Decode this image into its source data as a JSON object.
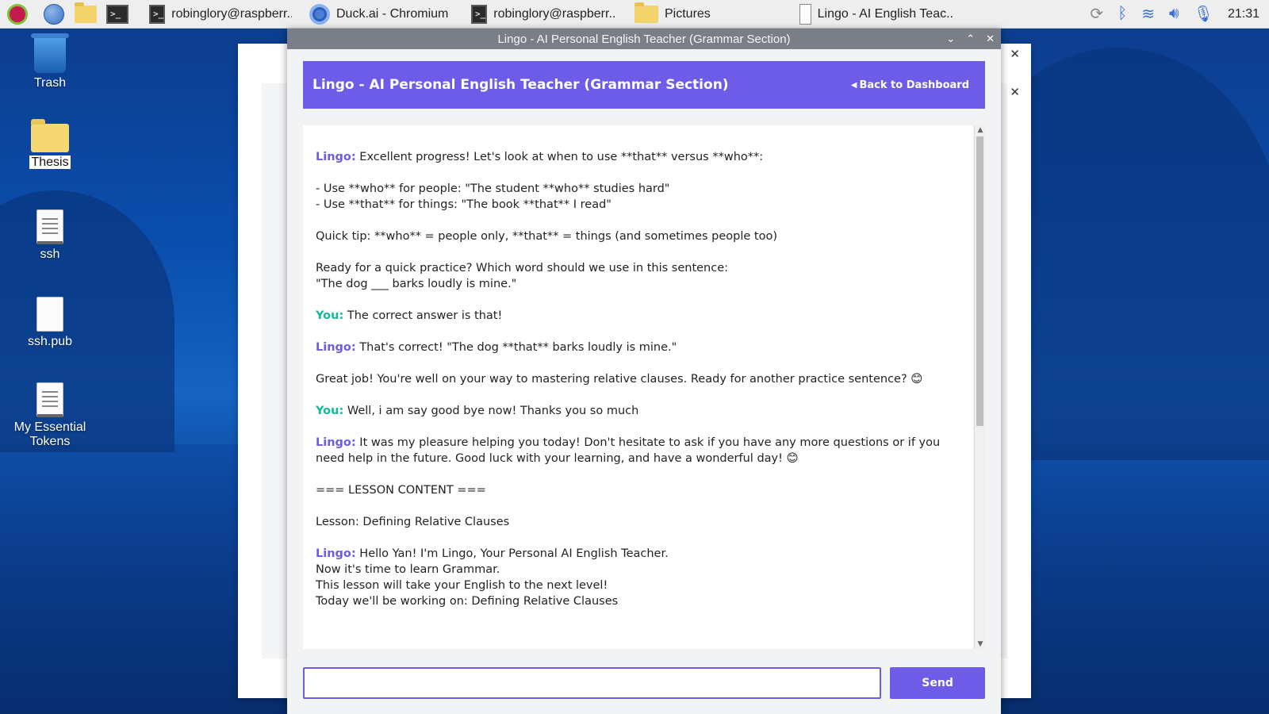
{
  "taskbar": {
    "tasks": [
      {
        "label": "robinglory@raspberr..",
        "icon": "terminal-icon"
      },
      {
        "label": "Duck.ai - Chromium",
        "icon": "chromium-icon"
      },
      {
        "label": "robinglory@raspberr..",
        "icon": "terminal-icon"
      },
      {
        "label": "Pictures",
        "icon": "folder-icon"
      },
      {
        "label": "Lingo - AI English Teac..",
        "icon": "document-icon"
      }
    ],
    "clock": "21:31",
    "tray_icons": [
      "sync-icon",
      "bluetooth-icon",
      "wifi-icon",
      "volume-icon",
      "microphone-icon"
    ]
  },
  "desktop": {
    "icons": [
      {
        "label": "Trash",
        "icon": "trash-icon"
      },
      {
        "label": "Thesis",
        "icon": "folder-icon"
      },
      {
        "label": "ssh",
        "icon": "text-file-icon"
      },
      {
        "label": "ssh.pub",
        "icon": "file-icon"
      },
      {
        "label": "My Essential Tokens",
        "icon": "text-file-icon"
      }
    ]
  },
  "window": {
    "title": "Lingo - AI Personal English Teacher (Grammar Section)"
  },
  "header": {
    "title": "Lingo - AI Personal English Teacher (Grammar Section)",
    "back_label": "Back to Dashboard"
  },
  "chat": {
    "lingo_label": "Lingo:",
    "you_label": "You:",
    "m1_line1": "Excellent progress! Let's look at when to use **that** versus **who**:",
    "m1_line2": "- Use **who** for people: \"The student **who** studies hard\"",
    "m1_line3": "- Use **that** for things: \"The book **that** I read\"",
    "m1_line4": "Quick tip: **who** = people only, **that** = things (and sometimes people too)",
    "m1_line5": "Ready for a quick practice? Which word should we use in this sentence:",
    "m1_line6": "\"The dog ___ barks loudly is mine.\"",
    "m2": "The correct answer is that!",
    "m3_line1": "That's correct! \"The dog **that** barks loudly is mine.\"",
    "m3_line2": "Great job! You're well on your way to mastering relative clauses. Ready for another practice sentence? 😊",
    "m4": "Well, i am say good bye now! Thanks you so much",
    "m5": "It was my pleasure helping you today! Don't hesitate to ask if you have any more questions or if you need help in the future. Good luck with your learning, and have a wonderful day! 😊",
    "lesson_header": "=== LESSON CONTENT ===",
    "lesson_title": "Lesson: Defining Relative Clauses",
    "m6_line1": "Hello Yan! I'm Lingo, Your Personal AI English Teacher.",
    "m6_line2": "Now it's time to learn Grammar.",
    "m6_line3": "This lesson will take your English to the next level!",
    "m6_line4": "Today we'll be working on: Defining Relative Clauses"
  },
  "composer": {
    "value": "",
    "send_label": "Send"
  },
  "colors": {
    "accent": "#6c5ce7",
    "you": "#17b897"
  }
}
